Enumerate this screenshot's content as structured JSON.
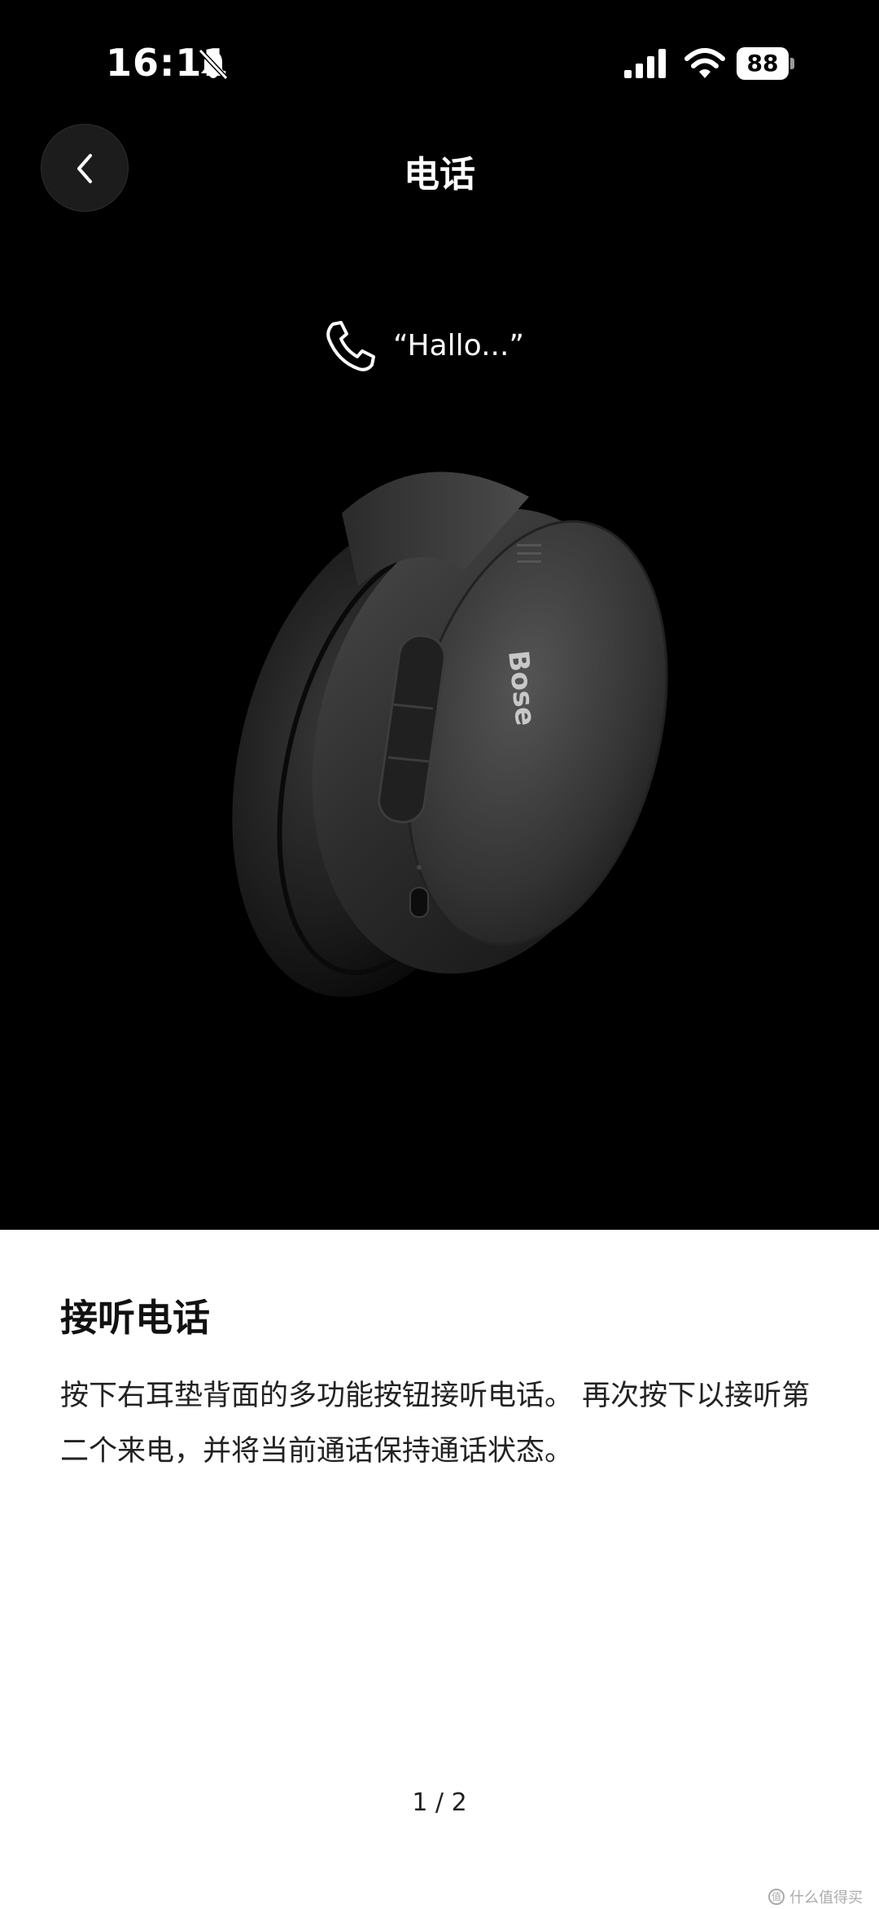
{
  "status_bar": {
    "time": "16:11",
    "battery": "88",
    "icons": [
      "bell-off-icon",
      "signal-icon",
      "wifi-icon",
      "battery-icon"
    ]
  },
  "nav": {
    "title": "电话",
    "back_icon": "chevron-left-icon"
  },
  "illustration": {
    "call_icon": "phone-icon",
    "call_caption": "“Hallo...”",
    "image": "headphone-earcup"
  },
  "content": {
    "title": "接听电话",
    "body": "按下右耳垫背面的多功能按钮接听电话。 再次按下以接听第二个来电，并将当前通话保持通话状态。"
  },
  "pager": {
    "label": "1 / 2"
  },
  "watermark": {
    "text": "什么值得买"
  },
  "colors": {
    "hero_bg": "#000000",
    "content_bg": "#ffffff",
    "text_dark": "#111111",
    "text_light": "#ffffff"
  }
}
